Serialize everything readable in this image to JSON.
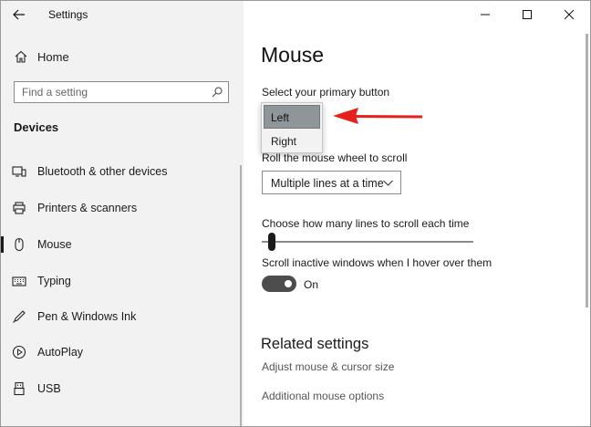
{
  "window": {
    "app_title": "Settings",
    "controls": [
      {
        "name": "minimize-button",
        "icon": "minimize-icon"
      },
      {
        "name": "maximize-button",
        "icon": "maximize-icon"
      },
      {
        "name": "close-button",
        "icon": "close-icon"
      }
    ]
  },
  "sidebar": {
    "home_label": "Home",
    "search_placeholder": "Find a setting",
    "section_title": "Devices",
    "items": [
      {
        "label": "Bluetooth & other devices",
        "icon": "bluetooth-devices-icon",
        "selected": false
      },
      {
        "label": "Printers & scanners",
        "icon": "printer-icon",
        "selected": false
      },
      {
        "label": "Mouse",
        "icon": "mouse-icon",
        "selected": true
      },
      {
        "label": "Typing",
        "icon": "keyboard-icon",
        "selected": false
      },
      {
        "label": "Pen & Windows Ink",
        "icon": "pen-icon",
        "selected": false
      },
      {
        "label": "AutoPlay",
        "icon": "autoplay-icon",
        "selected": false
      },
      {
        "label": "USB",
        "icon": "usb-icon",
        "selected": false
      }
    ]
  },
  "main": {
    "title": "Mouse",
    "primary_button": {
      "label": "Select your primary button",
      "options": [
        "Left",
        "Right"
      ],
      "selected": "Left"
    },
    "roll_wheel": {
      "label": "Roll the mouse wheel to scroll",
      "value": "Multiple lines at a time"
    },
    "lines_to_scroll": {
      "label": "Choose how many lines to scroll each time",
      "level_fraction": 0.03
    },
    "inactive_scroll": {
      "label": "Scroll inactive windows when I hover over them",
      "state": "On"
    },
    "related": {
      "title": "Related settings",
      "links": [
        "Adjust mouse & cursor size",
        "Additional mouse options"
      ]
    }
  },
  "colors": {
    "sidebar_bg": "#f2f2f2",
    "selected_option_bg": "#8f969a",
    "toggle_on": "#4d4d4d",
    "annotation_arrow": "#e8201b"
  }
}
